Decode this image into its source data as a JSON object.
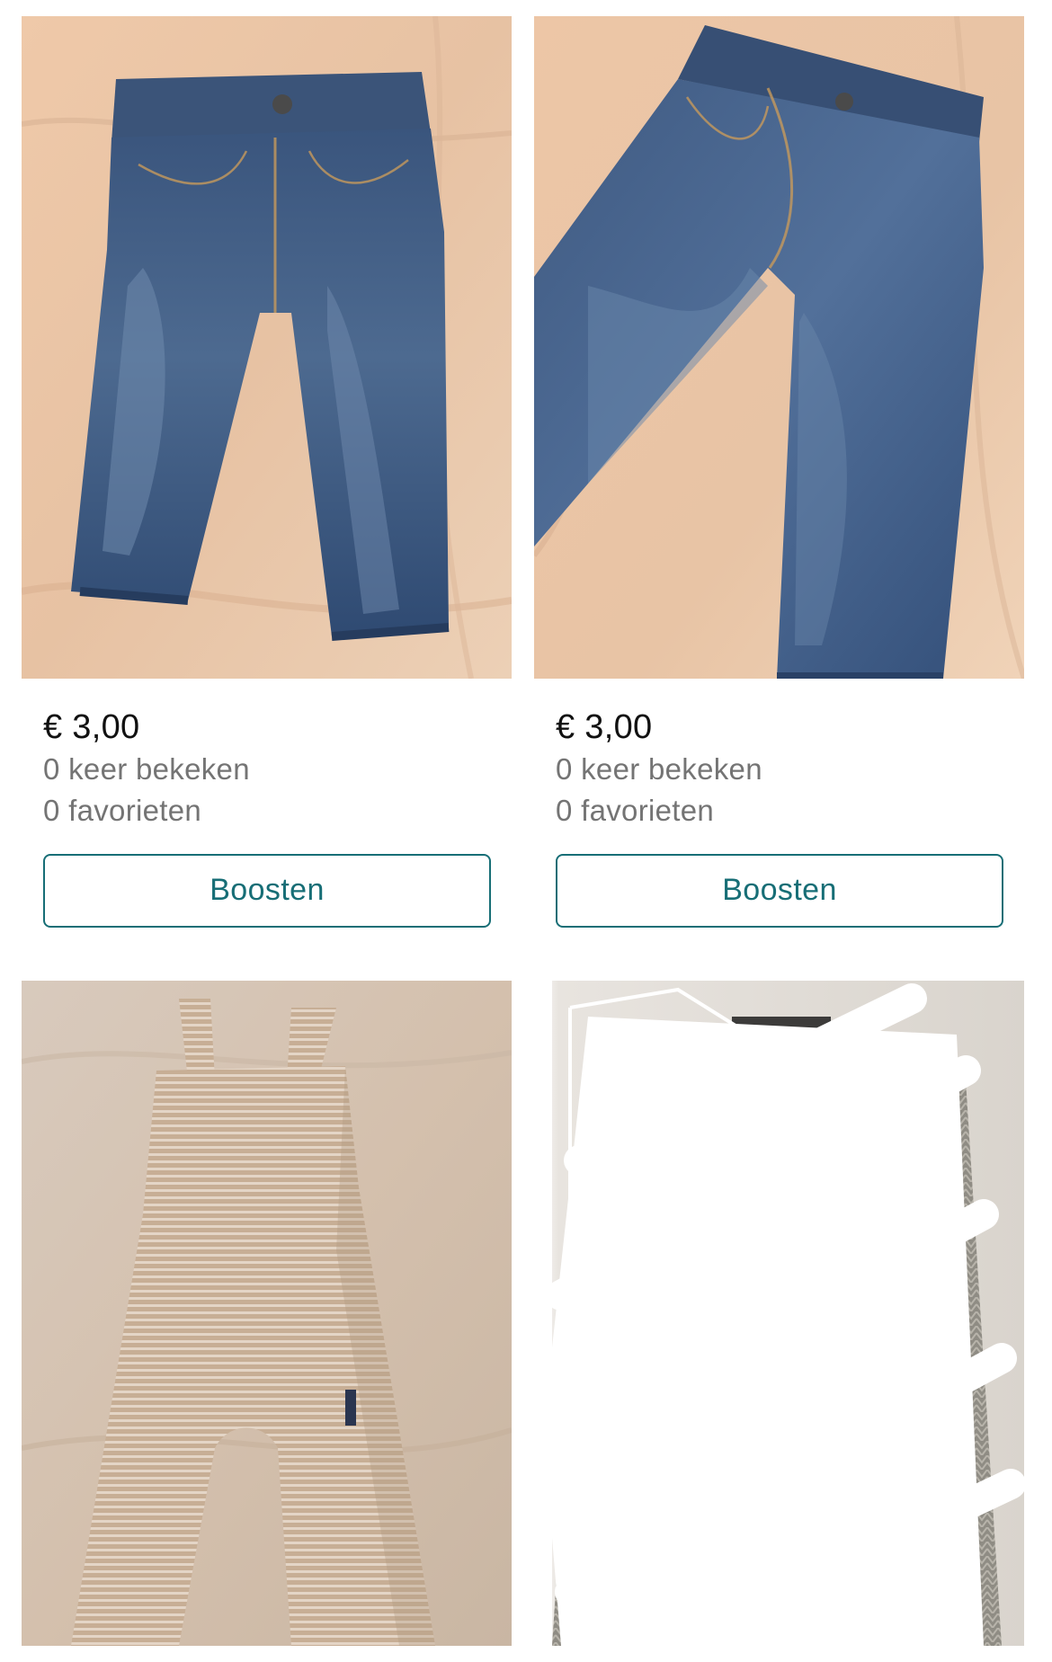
{
  "listings": [
    {
      "price": "€ 3,00",
      "views": "0 keer bekeken",
      "favorites": "0 favorieten",
      "action_label": "Boosten",
      "photo": "jeans-front-photo"
    },
    {
      "price": "€ 3,00",
      "views": "0 keer bekeken",
      "favorites": "0 favorieten",
      "action_label": "Boosten",
      "photo": "jeans-side-photo"
    },
    {
      "photo": "striped-dungarees-photo"
    },
    {
      "photo": "censored-knit-cardigan-photo"
    }
  ],
  "colors": {
    "accent": "#176e76",
    "price_text": "#111111",
    "meta_text": "#747474",
    "background": "#ffffff"
  }
}
